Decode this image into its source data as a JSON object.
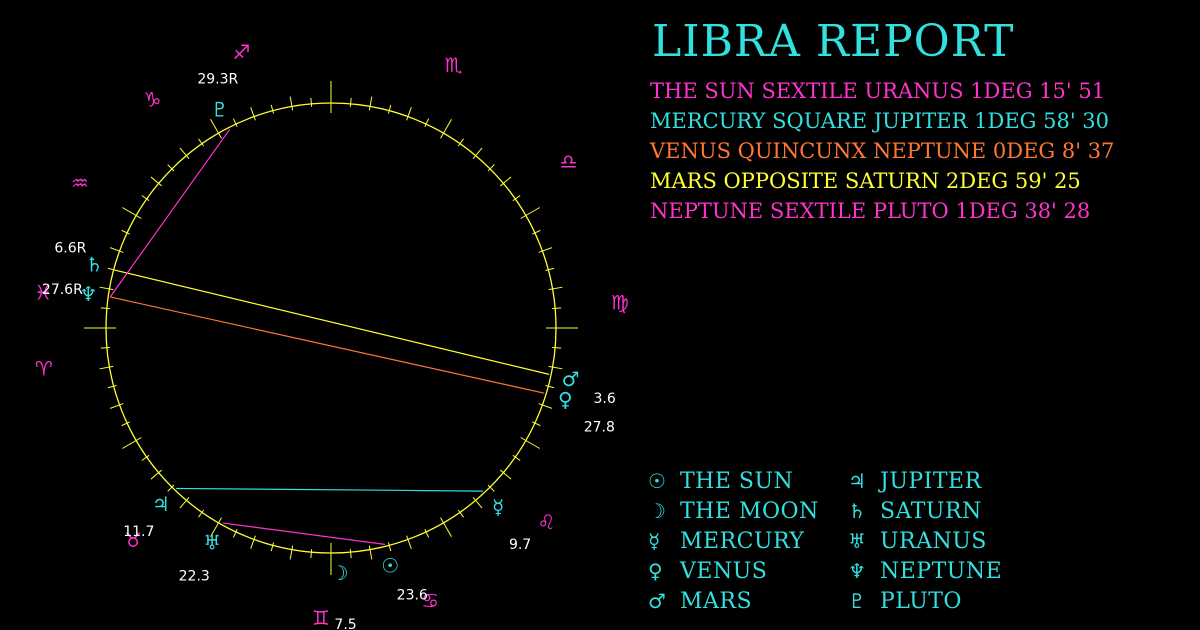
{
  "title": "LIBRA REPORT",
  "colors": {
    "background": "#000000",
    "ring": "#ffff33",
    "zodiac_sign": "#ff33cc",
    "planet": "#33e0e0",
    "degree_label": "#ffffff"
  },
  "aspects": [
    {
      "text": "THE SUN SEXTILE URANUS 1DEG 15' 51",
      "color": "#ff33cc"
    },
    {
      "text": "MERCURY SQUARE JUPITER 1DEG 58' 30",
      "color": "#33e0e0"
    },
    {
      "text": "VENUS QUINCUNX NEPTUNE 0DEG 8' 37",
      "color": "#ff7733"
    },
    {
      "text": "MARS OPPOSITE SATURN 2DEG 59' 25",
      "color": "#ffff33"
    },
    {
      "text": "NEPTUNE SEXTILE PLUTO 1DEG 38' 28",
      "color": "#ff33cc"
    }
  ],
  "zodiac_signs": [
    {
      "name": "aries",
      "glyph": "♈"
    },
    {
      "name": "taurus",
      "glyph": "♉"
    },
    {
      "name": "gemini",
      "glyph": "♊"
    },
    {
      "name": "cancer",
      "glyph": "♋"
    },
    {
      "name": "leo",
      "glyph": "♌"
    },
    {
      "name": "virgo",
      "glyph": "♍"
    },
    {
      "name": "libra",
      "glyph": "♎"
    },
    {
      "name": "scorpio",
      "glyph": "♏"
    },
    {
      "name": "sagittarius",
      "glyph": "♐"
    },
    {
      "name": "capricorn",
      "glyph": "♑"
    },
    {
      "name": "aquarius",
      "glyph": "♒"
    },
    {
      "name": "pisces",
      "glyph": "♓"
    }
  ],
  "planets": [
    {
      "name": "sun",
      "glyph": "☉",
      "label": "23.6"
    },
    {
      "name": "moon",
      "glyph": "☽",
      "label": "7.5"
    },
    {
      "name": "mercury",
      "glyph": "☿",
      "label": "9.7"
    },
    {
      "name": "venus",
      "glyph": "♀",
      "label": "27.8"
    },
    {
      "name": "mars",
      "glyph": "♂",
      "label": "3.6"
    },
    {
      "name": "jupiter",
      "glyph": "♃",
      "label": "11.7"
    },
    {
      "name": "saturn",
      "glyph": "♄",
      "label": "6.6R"
    },
    {
      "name": "uranus",
      "glyph": "♅",
      "label": "22.3"
    },
    {
      "name": "neptune",
      "glyph": "♆",
      "label": "27.6R"
    },
    {
      "name": "pluto",
      "glyph": "♇",
      "label": "29.3R"
    }
  ],
  "aspect_lines": [
    {
      "from": "sun",
      "to": "uranus",
      "color": "#ff33cc"
    },
    {
      "from": "mercury",
      "to": "jupiter",
      "color": "#33e0e0"
    },
    {
      "from": "venus",
      "to": "neptune",
      "color": "#ff7733"
    },
    {
      "from": "mars",
      "to": "saturn",
      "color": "#ffff33"
    },
    {
      "from": "neptune",
      "to": "pluto",
      "color": "#ff33cc"
    }
  ],
  "legend": [
    {
      "glyph": "☉",
      "label": "THE SUN"
    },
    {
      "glyph": "☽",
      "label": "THE MOON"
    },
    {
      "glyph": "☿",
      "label": "MERCURY"
    },
    {
      "glyph": "♀",
      "label": "VENUS"
    },
    {
      "glyph": "♂",
      "label": "MARS"
    },
    {
      "glyph": "♃",
      "label": "JUPITER"
    },
    {
      "glyph": "♄",
      "label": "SATURN"
    },
    {
      "glyph": "♅",
      "label": "URANUS"
    },
    {
      "glyph": "♆",
      "label": "NEPTUNE"
    },
    {
      "glyph": "♇",
      "label": "PLUTO"
    }
  ]
}
